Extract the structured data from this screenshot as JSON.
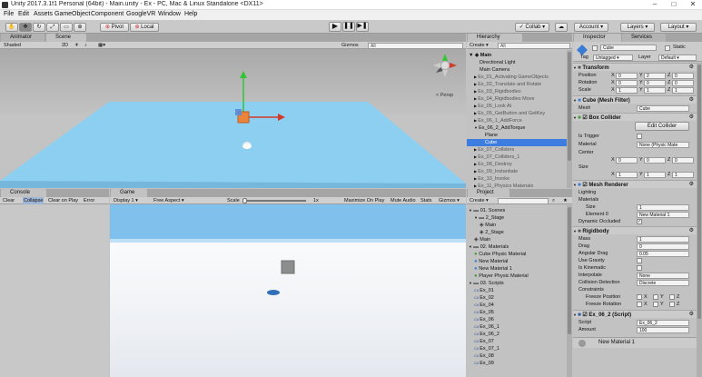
{
  "window": {
    "title": "Unity 2017.3.1f1 Personal (64bit) - Main.unity - Ex - PC, Mac & Linux Standalone <DX11>"
  },
  "menu": [
    "File",
    "Edit",
    "Assets",
    "GameObject",
    "Component",
    "GoogleVR",
    "Window",
    "Help"
  ],
  "toolbar": {
    "pivot": "Pivot",
    "local": "Local",
    "collab": "Collab",
    "account": "Account",
    "layers": "Layers",
    "layout": "Layout"
  },
  "tabs": {
    "animator": "Animator",
    "scene": "Scene",
    "hierarchy": "Hierarchy",
    "inspector": "Inspector",
    "services": "Services",
    "console": "Console",
    "game": "Game",
    "project": "Project"
  },
  "scene_bar": {
    "shaded": "Shaded",
    "twoD": "2D",
    "gizmos": "Gizmos",
    "search": "All",
    "persp": "< Persp"
  },
  "hierarchy": {
    "create": "Create",
    "search": "All",
    "scene": "Main",
    "items": [
      "Directional Light",
      "Main Camera",
      "Ex_01_Activating GameObjects",
      "Ex_02_Translate and Rotate",
      "Ex_03_Rigidbodies",
      "Ex_04_Rigidbodies Move",
      "Ex_05_Look At",
      "Ex_05_GetButton and GetKey",
      "Ex_06_1_AddForce",
      "Ex_06_2_AddTorque",
      "Plane",
      "Cube",
      "Ex_07_Colliders",
      "Ex_07_Colliders_1",
      "Ex_08_Destroy",
      "Ex_09_Instantiate",
      "Ex_10_Invoke",
      "Ex_11_Physics Materials"
    ]
  },
  "console": {
    "clear": "Clear",
    "collapse": "Collapse",
    "clear_on_play": "Clear on Play",
    "error_pause": "Error Pause"
  },
  "game_bar": {
    "display": "Display 1",
    "aspect": "Free Aspect",
    "scale": "Scale",
    "scale_val": "1x",
    "maximize": "Maximize On Play",
    "mute": "Mute Audio",
    "stats": "Stats",
    "gizmos": "Gizmos"
  },
  "project": {
    "create": "Create",
    "items": [
      "01. Scenes",
      "2_Stage",
      "Main",
      "2_Stage",
      "Main",
      "02. Materials",
      "Cube Physic Material",
      "New Material",
      "New Material 1",
      "Player Physic Material",
      "03. Scripts",
      "Ex_01",
      "Ex_02",
      "Ex_04",
      "Ex_05",
      "Ex_06",
      "Ex_06_1",
      "Ex_06_2",
      "Ex_07",
      "Ex_07_1",
      "Ex_08",
      "Ex_09"
    ]
  },
  "inspector": {
    "name": "Cube",
    "static": "Static",
    "tag_label": "Tag",
    "tag": "Untagged",
    "layer_label": "Layer",
    "layer": "Default",
    "transform": {
      "title": "Transform",
      "position": "Position",
      "rotation": "Rotation",
      "scale": "Scale",
      "pos": [
        "0",
        "2",
        "0"
      ],
      "rot": [
        "0",
        "0",
        "0"
      ],
      "scl": [
        "1",
        "1",
        "1"
      ]
    },
    "mesh_filter": {
      "title": "Cube (Mesh Filter)",
      "mesh_label": "Mesh",
      "mesh": "Cube"
    },
    "box_collider": {
      "title": "Box Collider",
      "edit": "Edit Collider",
      "is_trigger": "Is Trigger",
      "material": "Material",
      "material_val": "None (Physic Mate",
      "center": "Center",
      "size": "Size",
      "center_vals": [
        "0",
        "0",
        "0"
      ],
      "size_vals": [
        "1",
        "1",
        "1"
      ]
    },
    "mesh_renderer": {
      "title": "Mesh Renderer",
      "lighting": "Lighting",
      "materials": "Materials",
      "size": "Size",
      "size_val": "1",
      "element": "Element 0",
      "element_val": "New Material 1",
      "dynamic": "Dynamic Occluded"
    },
    "rigidbody": {
      "title": "Rigidbody",
      "mass": "Mass",
      "mass_val": "1",
      "drag": "Drag",
      "drag_val": "0",
      "angular": "Angular Drag",
      "angular_val": "0.05",
      "gravity": "Use Gravity",
      "kinematic": "Is Kinematic",
      "interpolate": "Interpolate",
      "interpolate_val": "None",
      "collision": "Collision Detection",
      "collision_val": "Discrete",
      "constraints": "Constraints",
      "freeze_pos": "Freeze Position",
      "freeze_rot": "Freeze Rotation",
      "axes": [
        "X",
        "Y",
        "Z"
      ]
    },
    "script": {
      "title": "Ex_06_2 (Script)",
      "script_label": "Script",
      "script_val": "Ex_06_2",
      "amount": "Amount",
      "amount_val": "100"
    },
    "footer": "New Material 1"
  }
}
